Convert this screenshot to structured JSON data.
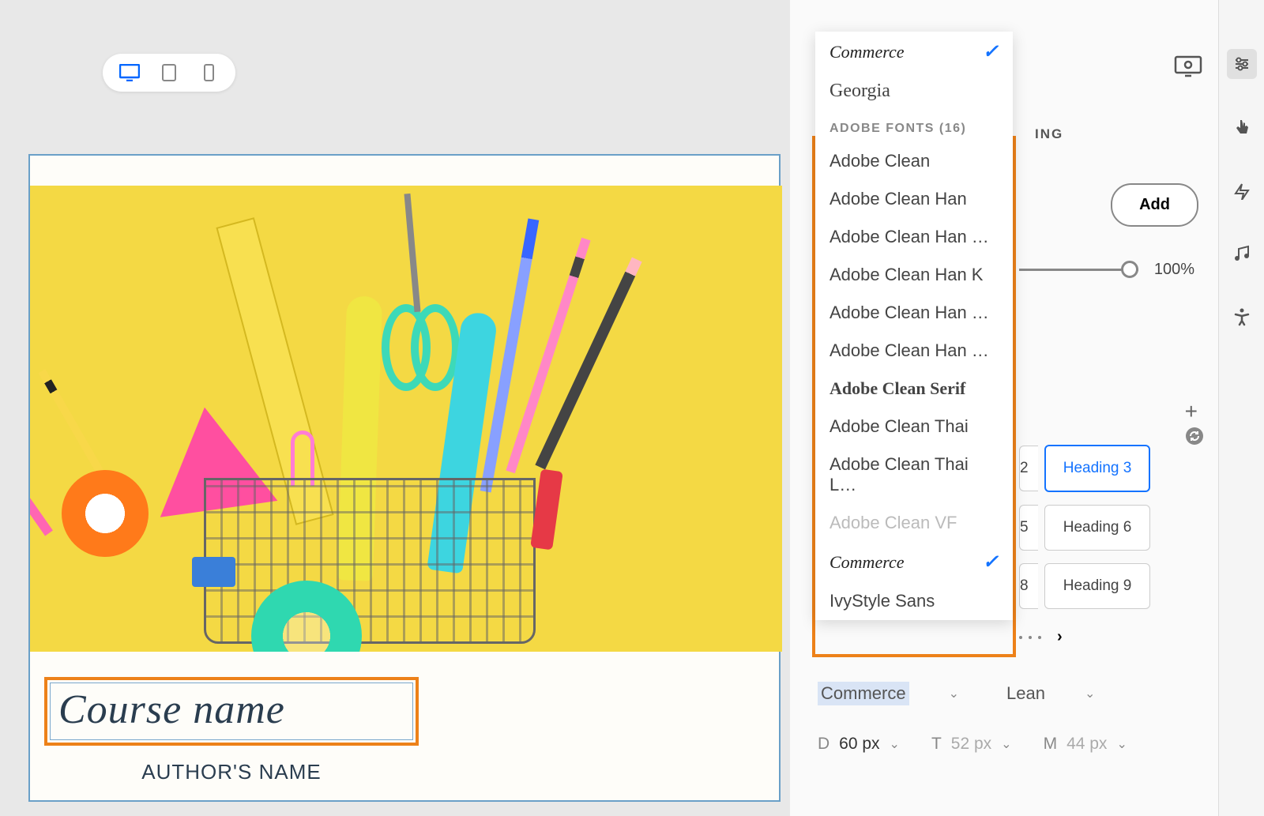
{
  "devices": [
    "desktop",
    "tablet",
    "phone"
  ],
  "canvas": {
    "course_name": "Course name",
    "author_name": "AUTHOR'S NAME"
  },
  "font_dropdown": {
    "top_items": [
      {
        "label": "Commerce",
        "style": "italic",
        "selected": true
      },
      {
        "label": "Georgia",
        "style": "georgia"
      }
    ],
    "section_header": "ADOBE FONTS (16)",
    "adobe_fonts": [
      {
        "label": "Adobe Clean"
      },
      {
        "label": "Adobe Clean Han"
      },
      {
        "label": "Adobe Clean Han …"
      },
      {
        "label": "Adobe Clean Han K"
      },
      {
        "label": "Adobe Clean Han …"
      },
      {
        "label": "Adobe Clean Han …"
      },
      {
        "label": "Adobe Clean Serif",
        "style": "serif"
      },
      {
        "label": "Adobe Clean Thai"
      },
      {
        "label": "Adobe Clean Thai L…"
      },
      {
        "label": "Adobe Clean VF",
        "disabled": true
      },
      {
        "label": "Commerce",
        "style": "italic",
        "selected": true
      },
      {
        "label": "IvyStyle Sans"
      }
    ]
  },
  "panel": {
    "header_partial": "ING",
    "add_btn": "Add",
    "slider_value": "100%",
    "headings": [
      {
        "label": "2"
      },
      {
        "label": "Heading 3",
        "selected": true
      },
      {
        "label": "5"
      },
      {
        "label": "Heading 6"
      },
      {
        "label": "8"
      },
      {
        "label": "Heading 9"
      }
    ]
  },
  "font_selectors": {
    "font": "Commerce",
    "weight": "Lean"
  },
  "sizes": {
    "d_label": "D",
    "d_value": "60 px",
    "t_label": "T",
    "t_value": "52 px",
    "m_label": "M",
    "m_value": "44 px"
  }
}
